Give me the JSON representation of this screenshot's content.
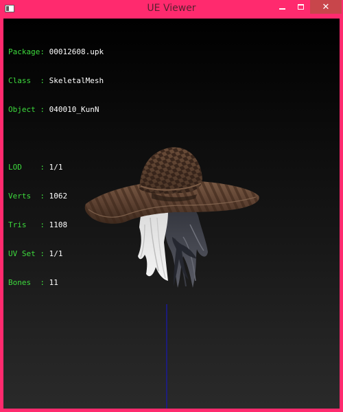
{
  "window": {
    "title": "UE Viewer",
    "controls": {
      "minimize_icon": "minimize-icon",
      "maximize_icon": "maximize-icon",
      "close_icon": "close-icon",
      "close_glyph": "✕"
    }
  },
  "colors": {
    "frame": "#ff2a6e",
    "close_button": "#c8464b",
    "label_text": "#3ddc3d",
    "value_text": "#ffffff",
    "axis_line": "#1a1aa0"
  },
  "info": {
    "package": {
      "label": "Package:",
      "value": "00012608.upk"
    },
    "class": {
      "label": "Class  :",
      "value": "SkeletalMesh"
    },
    "object": {
      "label": "Object :",
      "value": "040010_KunN"
    },
    "lod": {
      "label": "LOD    :",
      "value": "1/1"
    },
    "verts": {
      "label": "Verts  :",
      "value": "1062"
    },
    "tris": {
      "label": "Tris   :",
      "value": "1108"
    },
    "uvset": {
      "label": "UV Set :",
      "value": "1/1"
    },
    "bones": {
      "label": "Bones  :",
      "value": "11"
    }
  },
  "model": {
    "description_icon": "skeletal-mesh-hat-hair"
  }
}
